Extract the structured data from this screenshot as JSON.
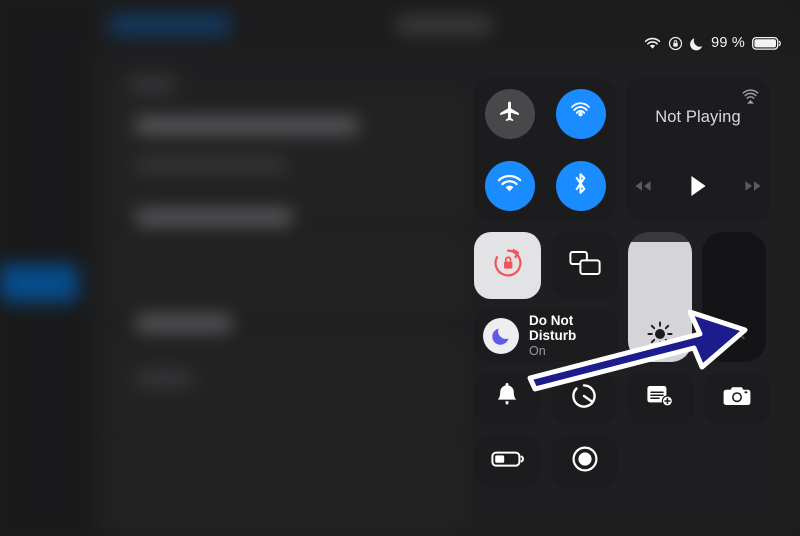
{
  "status_bar": {
    "wifi_icon": "wifi-icon",
    "rotation_lock_icon": "rotation-lock-icon",
    "dnd_icon": "moon-icon",
    "battery_percent": "99 %",
    "battery_icon": "battery-full-icon"
  },
  "control_center": {
    "connectivity": {
      "toggles": [
        {
          "name": "airplane-mode",
          "icon": "airplane-icon",
          "state": "off"
        },
        {
          "name": "airdrop",
          "icon": "airdrop-icon",
          "state": "on"
        },
        {
          "name": "wifi",
          "icon": "wifi-icon",
          "state": "on"
        },
        {
          "name": "bluetooth",
          "icon": "bluetooth-icon",
          "state": "on"
        }
      ]
    },
    "media": {
      "title": "Not Playing",
      "airplay_icon": "airplay-icon",
      "controls": [
        {
          "name": "rewind",
          "icon": "rewind-icon"
        },
        {
          "name": "play",
          "icon": "play-icon"
        },
        {
          "name": "fast-forward",
          "icon": "fast-forward-icon"
        }
      ]
    },
    "rotation_lock": {
      "icon": "rotation-lock-icon",
      "state": "on"
    },
    "screen_mirroring": {
      "icon": "screen-mirroring-icon",
      "state": "off"
    },
    "do_not_disturb": {
      "line1": "Do Not",
      "line2": "Disturb",
      "status": "On",
      "icon": "moon-icon"
    },
    "brightness": {
      "icon": "brightness-icon",
      "level_percent": 92
    },
    "volume": {
      "icon": "volume-mute-icon",
      "level_percent": 0,
      "muted": true
    },
    "tiles": [
      {
        "name": "alarm",
        "icon": "bell-icon"
      },
      {
        "name": "timer",
        "icon": "timer-icon"
      },
      {
        "name": "notes",
        "icon": "note-add-icon"
      },
      {
        "name": "camera",
        "icon": "camera-icon"
      },
      {
        "name": "low-power-mode",
        "icon": "battery-low-icon"
      },
      {
        "name": "screen-recording",
        "icon": "record-icon"
      }
    ]
  },
  "annotation": {
    "arrow": {
      "name": "pointer-arrow",
      "color": "#1c1c8c",
      "outline": "#ffffff",
      "points_to": "volume-mute-icon"
    }
  },
  "colors": {
    "accent_blue": "#1a8cff",
    "panel": "#1c1c1e",
    "active_tile": "#e3e3e6",
    "lock_red": "#f2545b",
    "moon_purple": "#5e5ce6"
  }
}
